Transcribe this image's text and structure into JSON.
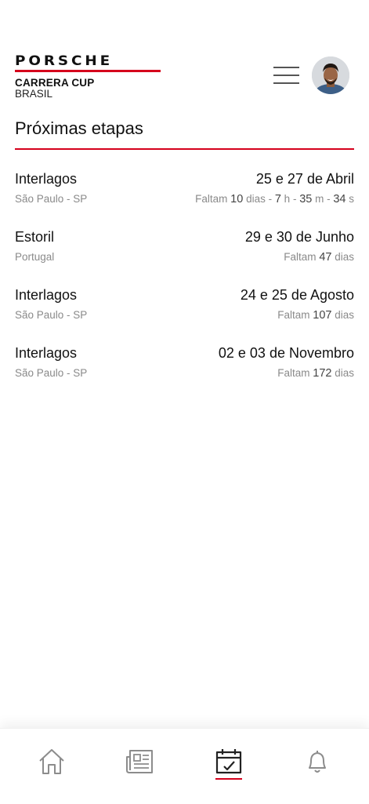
{
  "header": {
    "brand_wordmark": "PORSCHE",
    "brand_product": "CARRERA CUP",
    "brand_country": "BRASIL"
  },
  "colors": {
    "accent": "#d5001c",
    "text": "#111111",
    "muted": "#8a8a8a"
  },
  "main": {
    "title": "Próximas etapas",
    "races": [
      {
        "name": "Interlagos",
        "place": "São Paulo - SP",
        "dates": "25 e 27 de Abril",
        "countdown_prefix": "Faltam",
        "days": "10",
        "days_label": "dias",
        "hours": "7",
        "hours_label": "h",
        "minutes": "35",
        "minutes_label": "m",
        "seconds": "34",
        "seconds_label": "s"
      },
      {
        "name": "Estoril",
        "place": "Portugal",
        "dates": "29 e 30 de Junho",
        "countdown_prefix": "Faltam",
        "days": "47",
        "days_label": "dias"
      },
      {
        "name": "Interlagos",
        "place": "São Paulo - SP",
        "dates": "24 e 25 de Agosto",
        "countdown_prefix": "Faltam",
        "days": "107",
        "days_label": "dias"
      },
      {
        "name": "Interlagos",
        "place": "São Paulo - SP",
        "dates": "02 e 03 de Novembro",
        "countdown_prefix": "Faltam",
        "days": "172",
        "days_label": "dias"
      }
    ]
  },
  "bottom_nav": {
    "items": [
      {
        "icon": "home-icon"
      },
      {
        "icon": "news-icon"
      },
      {
        "icon": "calendar-icon",
        "active": true
      },
      {
        "icon": "bell-icon"
      }
    ]
  }
}
